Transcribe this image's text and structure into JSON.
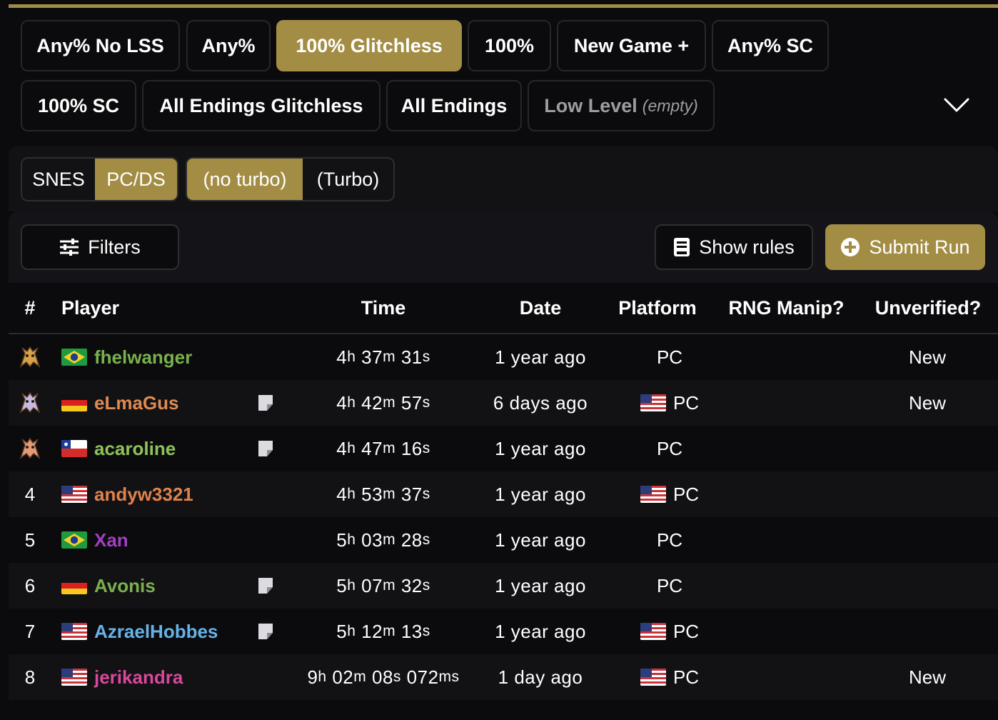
{
  "categories": {
    "row1": [
      {
        "label": "Any% No LSS",
        "active": false
      },
      {
        "label": "Any%",
        "active": false
      },
      {
        "label": "100% Glitchless",
        "active": true
      },
      {
        "label": "100%",
        "active": false
      },
      {
        "label": "New Game +",
        "active": false
      },
      {
        "label": "Any% SC",
        "active": false
      }
    ],
    "row2": [
      {
        "label": "100% SC"
      },
      {
        "label": "All Endings Glitchless"
      },
      {
        "label": "All Endings"
      },
      {
        "label": "Low Level",
        "suffix": "(empty)"
      }
    ]
  },
  "variables": {
    "platform": [
      {
        "label": "SNES",
        "on": false
      },
      {
        "label": "PC/DS",
        "on": true
      }
    ],
    "turbo": [
      {
        "label": "(no turbo)",
        "on": true
      },
      {
        "label": "(Turbo)",
        "on": false
      }
    ]
  },
  "toolbar": {
    "filters": "Filters",
    "show_rules": "Show rules",
    "submit_run": "Submit Run"
  },
  "table": {
    "headers": {
      "rank": "#",
      "player": "Player",
      "time": "Time",
      "date": "Date",
      "platform": "Platform",
      "rng": "RNG Manip?",
      "unverified": "Unverified?"
    },
    "rows": [
      {
        "rank": "",
        "trophy": "gold",
        "flag": "BR",
        "player": "fhelwanger",
        "color": "#7ab04d",
        "note": false,
        "h": "4",
        "m": "37",
        "s": "31",
        "ms": "",
        "date": "1 year ago",
        "platform": "PC",
        "plat_flag": false,
        "unverified": "New"
      },
      {
        "rank": "",
        "trophy": "silver",
        "flag": "DE",
        "player": "eLmaGus",
        "color": "#e08a4f",
        "note": true,
        "h": "4",
        "m": "42",
        "s": "57",
        "ms": "",
        "date": "6 days ago",
        "platform": "PC",
        "plat_flag": true,
        "unverified": "New"
      },
      {
        "rank": "",
        "trophy": "bronze",
        "flag": "CL",
        "player": "acaroline",
        "color": "#8ec25a",
        "note": true,
        "h": "4",
        "m": "47",
        "s": "16",
        "ms": "",
        "date": "1 year ago",
        "platform": "PC",
        "plat_flag": false,
        "unverified": ""
      },
      {
        "rank": "4",
        "trophy": "",
        "flag": "US",
        "player": "andyw3321",
        "color": "#e0824a",
        "note": false,
        "h": "4",
        "m": "53",
        "s": "37",
        "ms": "",
        "date": "1 year ago",
        "platform": "PC",
        "plat_flag": true,
        "unverified": ""
      },
      {
        "rank": "5",
        "trophy": "",
        "flag": "BR",
        "player": "Xan",
        "color": "#a23fc2",
        "note": false,
        "h": "5",
        "m": "03",
        "s": "28",
        "ms": "",
        "date": "1 year ago",
        "platform": "PC",
        "plat_flag": false,
        "unverified": ""
      },
      {
        "rank": "6",
        "trophy": "",
        "flag": "DE",
        "player": "Avonis",
        "color": "#7ab04d",
        "note": true,
        "h": "5",
        "m": "07",
        "s": "32",
        "ms": "",
        "date": "1 year ago",
        "platform": "PC",
        "plat_flag": false,
        "unverified": ""
      },
      {
        "rank": "7",
        "trophy": "",
        "flag": "US",
        "player": "AzraelHobbes",
        "color": "#66b2e8",
        "note": true,
        "h": "5",
        "m": "12",
        "s": "13",
        "ms": "",
        "date": "1 year ago",
        "platform": "PC",
        "plat_flag": true,
        "unverified": ""
      },
      {
        "rank": "8",
        "trophy": "",
        "flag": "US",
        "player": "jerikandra",
        "color": "#d9489a",
        "note": false,
        "h": "9",
        "m": "02",
        "s": "08",
        "ms": "072",
        "date": "1 day ago",
        "platform": "PC",
        "plat_flag": true,
        "unverified": "New"
      }
    ]
  },
  "colors": {
    "accent": "#a38d44",
    "background": "#0b0b0d"
  }
}
